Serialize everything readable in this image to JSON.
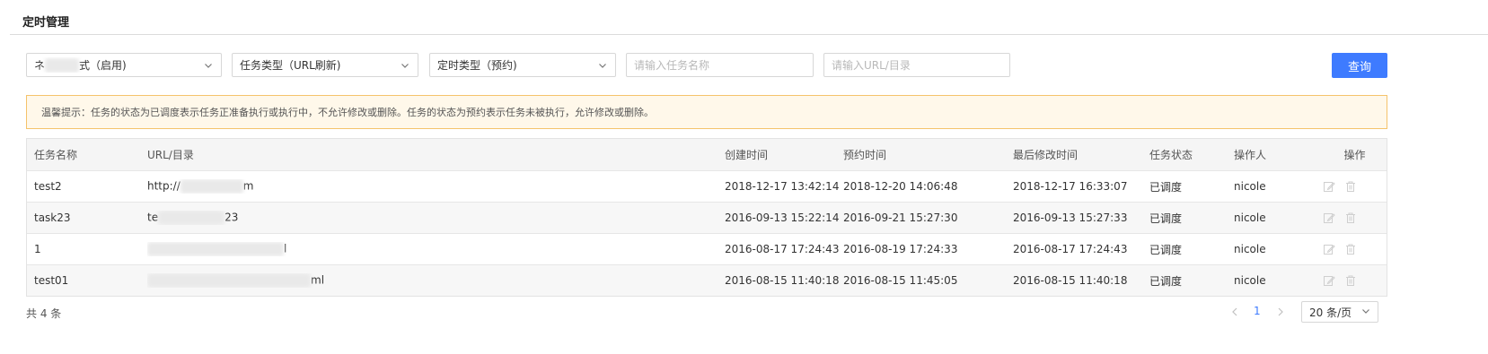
{
  "page": {
    "title": "定时管理"
  },
  "filters": {
    "mode": {
      "value_left": "ネ",
      "value_right": "式（启用)"
    },
    "task_type": {
      "value": "任务类型（URL刷新)"
    },
    "schedule_type": {
      "value": "定时类型（预约)"
    },
    "task_name": {
      "value": "",
      "placeholder": "请输入任务名称"
    },
    "url": {
      "value": "",
      "placeholder": "请输入URL/目录"
    },
    "query_label": "查询"
  },
  "notice": {
    "text": "温馨提示：任务的状态为已调度表示任务正准备执行或执行中，不允许修改或删除。任务的状态为预约表示任务未被执行，允许修改或删除。"
  },
  "table": {
    "headers": [
      "任务名称",
      "URL/目录",
      "创建时间",
      "预约时间",
      "最后修改时间",
      "任务状态",
      "操作人",
      "操作"
    ],
    "rows": [
      {
        "name": "test2",
        "url_start": "http://",
        "url_end": "m",
        "created": "2018-12-17 13:42:14",
        "scheduled": "2018-12-20 14:06:48",
        "modified": "2018-12-17 16:33:07",
        "status": "已调度",
        "operator": "nicole"
      },
      {
        "name": "task23",
        "url_start": "te",
        "url_end": "23",
        "created": "2016-09-13 15:22:14",
        "scheduled": "2016-09-21 15:27:30",
        "modified": "2016-09-13 15:27:33",
        "status": "已调度",
        "operator": "nicole"
      },
      {
        "name": "1",
        "url_start": "",
        "url_end": "l",
        "created": "2016-08-17 17:24:43",
        "scheduled": "2016-08-19 17:24:33",
        "modified": "2016-08-17 17:24:43",
        "status": "已调度",
        "operator": "nicole"
      },
      {
        "name": "test01",
        "url_start": "",
        "url_end": "ml",
        "created": "2016-08-15 11:40:18",
        "scheduled": "2016-08-15 11:45:05",
        "modified": "2016-08-15 11:40:18",
        "status": "已调度",
        "operator": "nicole"
      }
    ]
  },
  "footer": {
    "total": "共 4 条",
    "current_page": "1",
    "page_size": "20 条/页"
  },
  "icons": {
    "edit": "edit-icon",
    "delete": "trash-icon",
    "chevron": "chevron-down-icon"
  },
  "colors": {
    "primary": "#3e7bff",
    "notice_bg": "#fff8ea",
    "notice_border": "#f5c36b"
  }
}
